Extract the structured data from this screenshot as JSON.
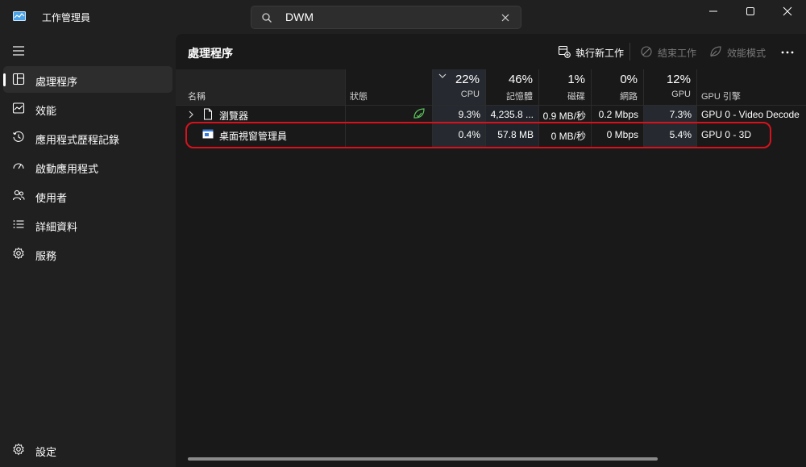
{
  "app": {
    "title": "工作管理員",
    "icon": "task-manager-icon"
  },
  "search": {
    "value": "DWM",
    "icon": "search-icon",
    "clear_icon": "close-icon"
  },
  "window_controls": {
    "minimize_icon": "minimize-icon",
    "maximize_icon": "maximize-icon",
    "close_icon": "close-icon"
  },
  "sidebar": {
    "menu_icon": "hamburger-icon",
    "items": [
      {
        "label": "處理程序",
        "icon": "processes-icon",
        "active": true
      },
      {
        "label": "效能",
        "icon": "performance-icon",
        "active": false
      },
      {
        "label": "應用程式歷程記錄",
        "icon": "history-icon",
        "active": false
      },
      {
        "label": "啟動應用程式",
        "icon": "speedometer-icon",
        "active": false
      },
      {
        "label": "使用者",
        "icon": "users-icon",
        "active": false
      },
      {
        "label": "詳細資料",
        "icon": "details-list-icon",
        "active": false
      },
      {
        "label": "服務",
        "icon": "services-gear-icon",
        "active": false
      }
    ],
    "settings": {
      "label": "設定",
      "icon": "settings-gear-icon"
    }
  },
  "page": {
    "title": "處理程序"
  },
  "toolbar": {
    "new_task": "執行新工作",
    "end_task": "結束工作",
    "efficiency": "效能模式",
    "more_icon": "more-ellipsis-icon"
  },
  "table": {
    "columns": {
      "name": "名稱",
      "status": "狀態",
      "cpu": {
        "pct": "22%",
        "label": "CPU"
      },
      "memory": {
        "pct": "46%",
        "label": "記憶體"
      },
      "disk": {
        "pct": "1%",
        "label": "磁碟"
      },
      "network": {
        "pct": "0%",
        "label": "網路"
      },
      "gpu": {
        "pct": "12%",
        "label": "GPU"
      },
      "gpu_engine": "GPU 引擎"
    },
    "rows": [
      {
        "name": "瀏覽器",
        "status_icon": "efficiency-leaf-icon",
        "cpu": "9.3%",
        "memory": "4,235.8 ...",
        "disk": "0.9 MB/秒",
        "network": "0.2 Mbps",
        "gpu": "7.3%",
        "gpu_engine": "GPU 0 - Video Decode"
      },
      {
        "name": "桌面視窗管理員",
        "status_icon": "",
        "cpu": "0.4%",
        "memory": "57.8 MB",
        "disk": "0 MB/秒",
        "network": "0 Mbps",
        "gpu": "5.4%",
        "gpu_engine": "GPU 0 - 3D"
      }
    ]
  },
  "colors": {
    "highlight": "#d8121c",
    "background": "#202020",
    "panel": "#191919"
  }
}
